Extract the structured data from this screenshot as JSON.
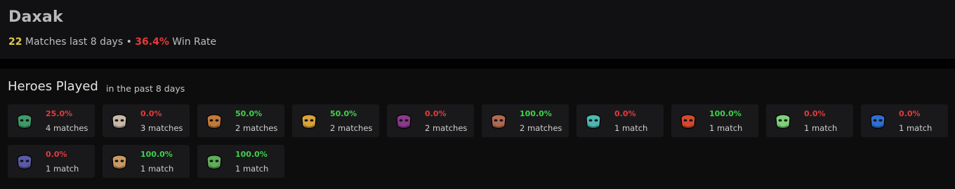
{
  "player": {
    "name": "Daxak",
    "match_count": "22",
    "matches_text": " Matches last 8 days • ",
    "win_rate": "36.4%",
    "win_rate_text": " Win Rate"
  },
  "heroes_section": {
    "title": "Heroes Played",
    "subtitle": "in the past 8 days"
  },
  "colors": {
    "win": "#3ed24a",
    "loss": "#e43a3a",
    "match_count": "#e2c84e"
  },
  "heroes": [
    {
      "icon": "green-beast-icon",
      "win_rate": "25.0%",
      "matches": "4 matches",
      "result": "loss",
      "color": "#3f9a6a"
    },
    {
      "icon": "white-bearded-hero-icon",
      "win_rate": "0.0%",
      "matches": "3 matches",
      "result": "loss",
      "color": "#c9b8a8"
    },
    {
      "icon": "bronze-warrior-icon",
      "win_rate": "50.0%",
      "matches": "2 matches",
      "result": "win",
      "color": "#c07a3a"
    },
    {
      "icon": "golden-bird-icon",
      "win_rate": "50.0%",
      "matches": "2 matches",
      "result": "win",
      "color": "#d9a23b"
    },
    {
      "icon": "purple-demon-icon",
      "win_rate": "0.0%",
      "matches": "2 matches",
      "result": "loss",
      "color": "#8a3a8a"
    },
    {
      "icon": "horned-beast-icon",
      "win_rate": "100.0%",
      "matches": "2 matches",
      "result": "win",
      "color": "#b06a52"
    },
    {
      "icon": "teal-maiden-icon",
      "win_rate": "0.0%",
      "matches": "1 match",
      "result": "loss",
      "color": "#4fb6b0"
    },
    {
      "icon": "red-gold-knight-icon",
      "win_rate": "100.0%",
      "matches": "1 match",
      "result": "win",
      "color": "#d4492f"
    },
    {
      "icon": "green-spirit-icon",
      "win_rate": "0.0%",
      "matches": "1 match",
      "result": "loss",
      "color": "#7fd07a"
    },
    {
      "icon": "blue-creature-icon",
      "win_rate": "0.0%",
      "matches": "1 match",
      "result": "loss",
      "color": "#2f6fd0"
    },
    {
      "icon": "dark-hooded-icon",
      "win_rate": "0.0%",
      "matches": "1 match",
      "result": "loss",
      "color": "#5a5aa8"
    },
    {
      "icon": "tan-feline-icon",
      "win_rate": "100.0%",
      "matches": "1 match",
      "result": "win",
      "color": "#c99a64"
    },
    {
      "icon": "jade-golem-icon",
      "win_rate": "100.0%",
      "matches": "1 match",
      "result": "win",
      "color": "#5fae5a"
    }
  ]
}
